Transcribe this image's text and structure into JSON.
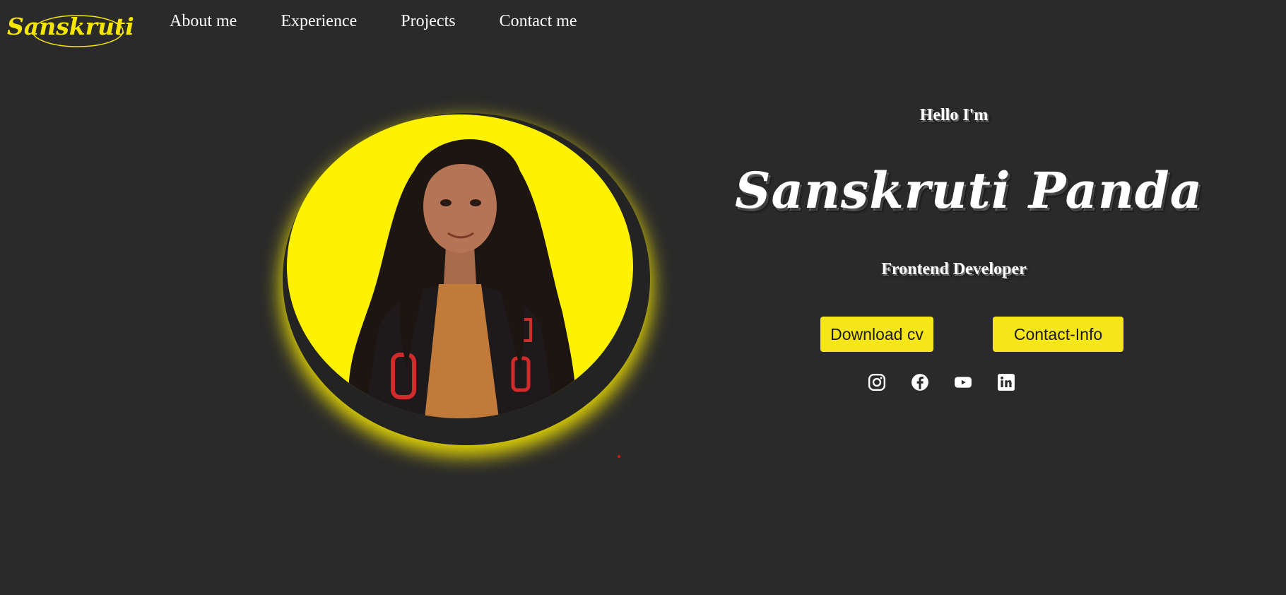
{
  "nav": {
    "logo_text": "Sanskruti",
    "links": [
      "About me",
      "Experience",
      "Projects",
      "Contact me"
    ]
  },
  "hero": {
    "greeting": "Hello I'm",
    "name": "Sanskruti Panda",
    "role": "Frontend Developer",
    "buttons": {
      "download_cv": "Download cv",
      "contact_info": "Contact-Info"
    },
    "socials": [
      "instagram-icon",
      "facebook-icon",
      "youtube-icon",
      "linkedin-icon"
    ]
  },
  "colors": {
    "background": "#2a2a2a",
    "accent": "#f5e61a",
    "text": "#ffffff"
  }
}
